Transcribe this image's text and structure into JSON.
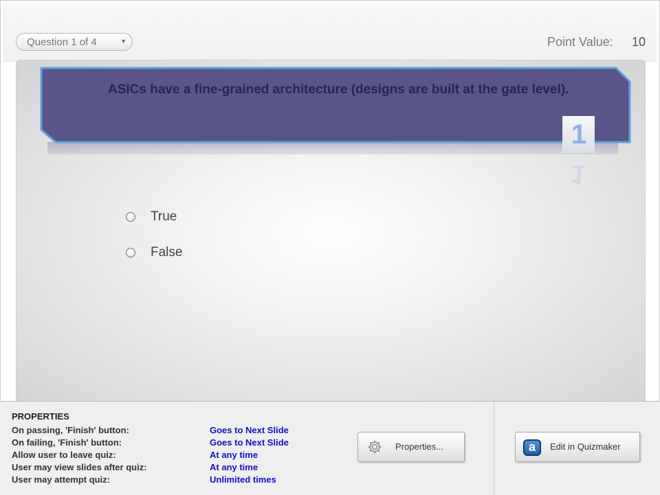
{
  "quiz": {
    "question_selector": "Question 1 of 4",
    "point_value_label": "Point Value:",
    "point_value": "10",
    "question_text": "ASICs have a fine-grained architecture (designs are built at the gate level).",
    "question_number": "1",
    "answers": [
      {
        "label": "True",
        "selected": false
      },
      {
        "label": "False",
        "selected": false
      }
    ]
  },
  "properties": {
    "title": "PROPERTIES",
    "rows": [
      {
        "label": "On passing, 'Finish' button:",
        "value": "Goes to Next Slide"
      },
      {
        "label": "On failing, 'Finish' button:",
        "value": "Goes to Next Slide"
      },
      {
        "label": "Allow user to leave quiz:",
        "value": "At any time"
      },
      {
        "label": "User may view slides after quiz:",
        "value": "At any time"
      },
      {
        "label": "User may attempt quiz:",
        "value": "Unlimited times"
      }
    ],
    "properties_button": "Properties...",
    "edit_button": "Edit in Quizmaker"
  },
  "icons": {
    "properties_button": "gear-icon",
    "edit_button": "quizmaker-icon",
    "question_selector": "chevron-down-icon"
  },
  "colors": {
    "question_banner": "#5a5589",
    "question_banner_border": "#5fa3d6",
    "property_value": "#1010c8"
  }
}
